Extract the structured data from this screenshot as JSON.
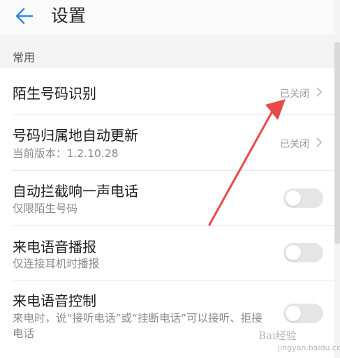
{
  "header": {
    "title": "设置",
    "back_icon": "arrow-left-icon"
  },
  "section": {
    "title": "常用"
  },
  "rows": [
    {
      "label": "陌生号码识别",
      "status": "已关闭"
    },
    {
      "label": "号码归属地自动更新",
      "sub": "当前版本：1.2.10.28",
      "status": "已关闭"
    },
    {
      "label": "自动拦截响一声电话",
      "sub": "仅限陌生号码",
      "toggle_on": false
    },
    {
      "label": "来电语音播报",
      "sub": "仅连接耳机时播报",
      "toggle_on": false
    },
    {
      "label": "来电语音控制",
      "sub": "来电时，说“接听电话”或“挂断电话”可以接听、拒接电话",
      "toggle_on": false
    }
  ],
  "watermark": {
    "text": "Bai经验",
    "sub": "jingyan.baidu.com"
  },
  "colors": {
    "accent": "#2a8de8",
    "annotation_arrow": "#e84a4a",
    "toggle_off": "#e5e5e5"
  }
}
